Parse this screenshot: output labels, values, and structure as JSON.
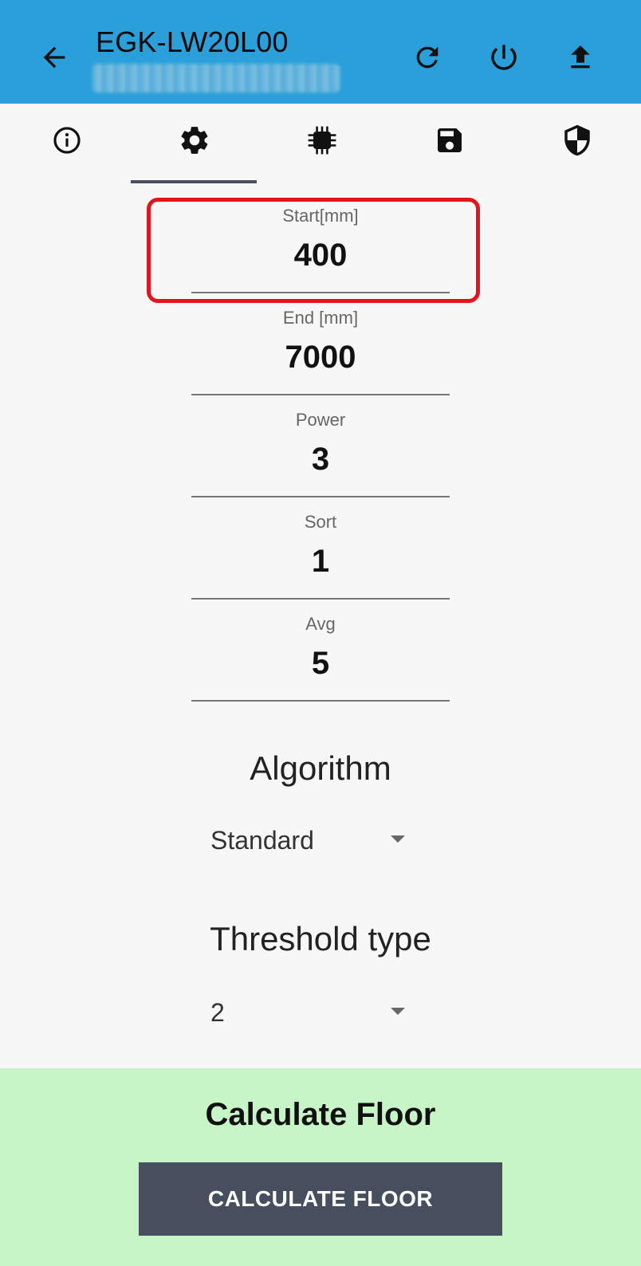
{
  "appbar": {
    "title": "EGK-LW20L00",
    "back_icon": "arrow-left-icon",
    "actions": [
      "refresh-icon",
      "power-icon",
      "upload-icon"
    ],
    "color": "#2a9fd9"
  },
  "tabs": {
    "items": [
      "info-icon",
      "gear-icon",
      "chip-icon",
      "save-icon",
      "shield-icon"
    ],
    "active_index": 1
  },
  "fields": [
    {
      "label": "Start[mm]",
      "value": "400",
      "highlighted": true
    },
    {
      "label": "End [mm]",
      "value": "7000"
    },
    {
      "label": "Power",
      "value": "3"
    },
    {
      "label": "Sort",
      "value": "1"
    },
    {
      "label": "Avg",
      "value": "5"
    }
  ],
  "algorithm": {
    "title": "Algorithm",
    "selected": "Standard"
  },
  "threshold": {
    "title": "Threshold type",
    "selected": "2"
  },
  "calculate": {
    "title": "Calculate Floor",
    "button_label": "CALCULATE FLOOR",
    "panel_color": "#c8f5c7",
    "button_color": "#474e5e"
  },
  "highlight_color": "#e5141b"
}
